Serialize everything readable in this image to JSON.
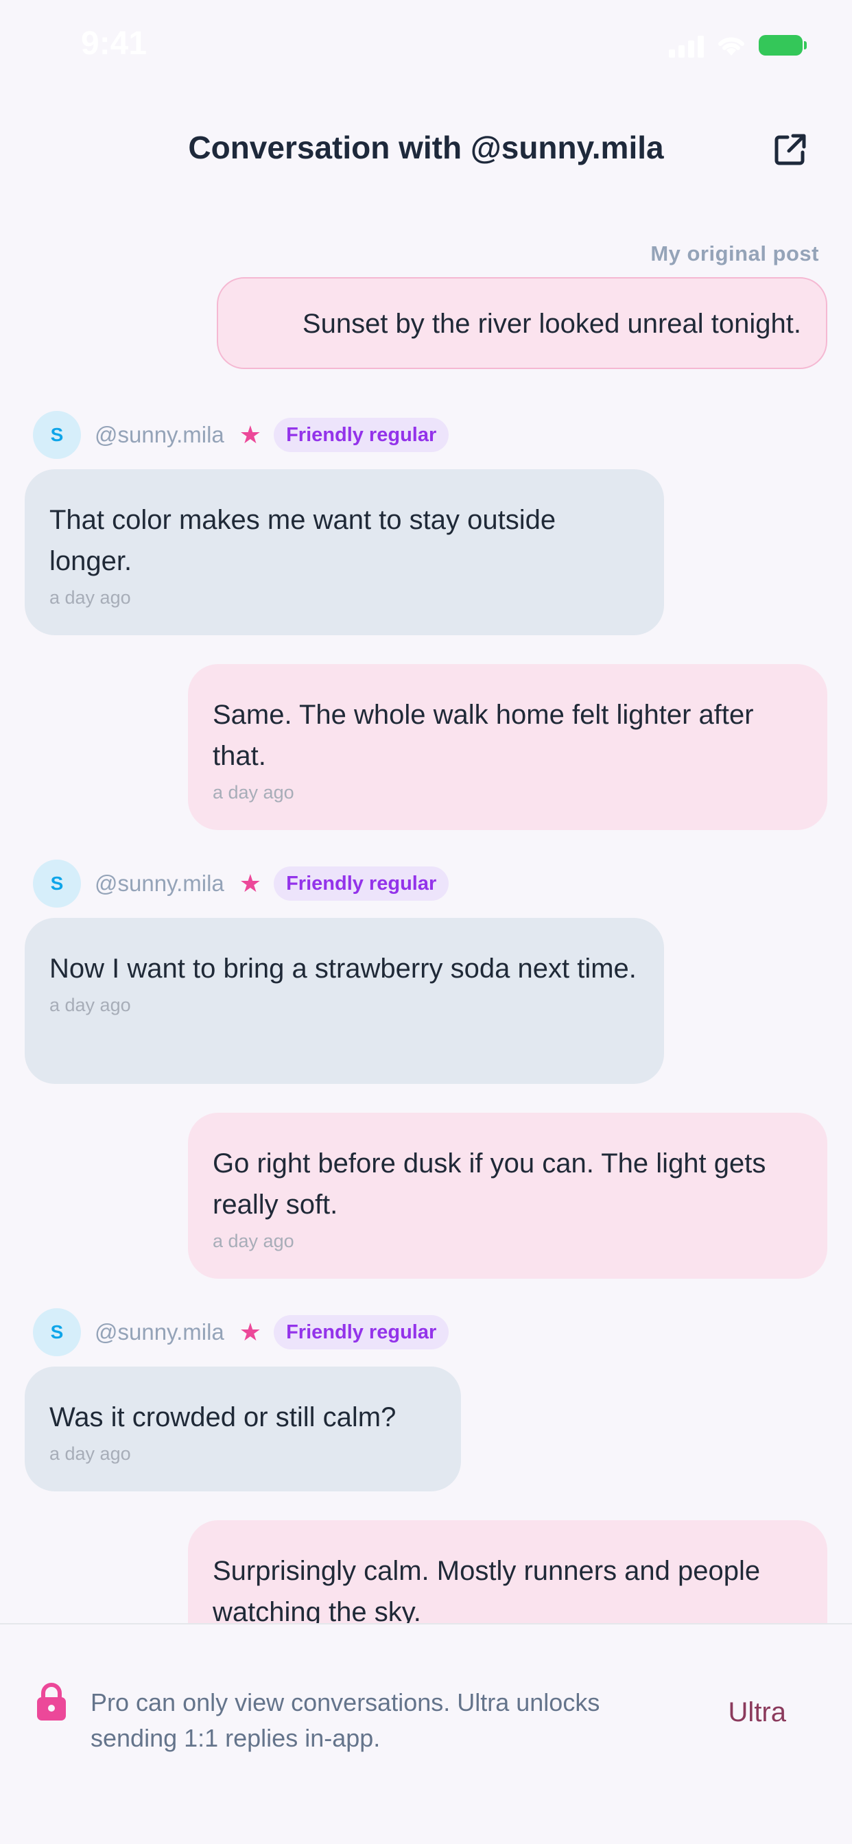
{
  "status_bar": {
    "time": "9:41"
  },
  "header": {
    "title": "Conversation with @sunny.mila"
  },
  "original": {
    "label": "My original post",
    "text": "Sunset by the river looked unreal tonight."
  },
  "sender": {
    "avatar_initial": "S",
    "handle": "@sunny.mila",
    "star": "★",
    "badge": "Friendly regular"
  },
  "messages": [
    {
      "from": "them",
      "text": "That color makes me want to stay outside longer.",
      "time": "a day ago"
    },
    {
      "from": "me",
      "text": "Same. The whole walk home felt lighter after that.",
      "time": "a day ago"
    },
    {
      "from": "them",
      "text": "Now I want to bring a strawberry soda next time.",
      "time": "a day ago"
    },
    {
      "from": "me",
      "text": "Go right before dusk if you can. The light gets really soft.",
      "time": "a day ago"
    },
    {
      "from": "them",
      "text": "Was it crowded or still calm?",
      "time": "a day ago"
    },
    {
      "from": "me",
      "text": "Surprisingly calm. Mostly runners and people watching the sky.",
      "time": ""
    }
  ],
  "footer": {
    "notice": "Pro can only view conversations. Ultra unlocks sending 1:1 replies in-app.",
    "upgrade_label": "Ultra"
  },
  "colors": {
    "accent": "#ec4899",
    "badge_text": "#9333ea",
    "their_bubble": "#e2e8f0",
    "my_bubble": "#fae3ee"
  }
}
